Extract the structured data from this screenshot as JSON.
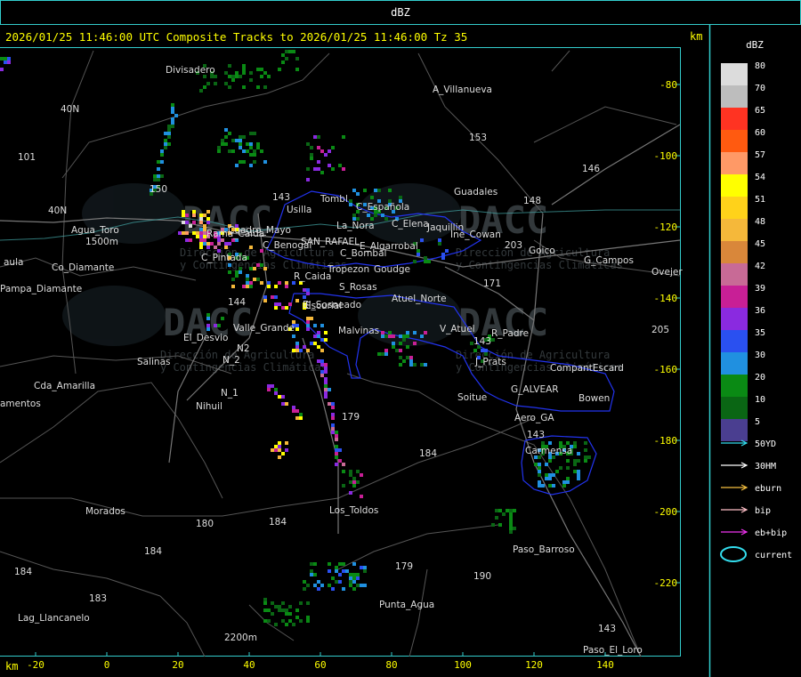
{
  "window": {
    "title": "dBZ"
  },
  "header": {
    "text": "2026/01/25 11:46:00 UTC Composite Tracks to 2026/01/25 11:46:00 Tz 35",
    "km_label": "km"
  },
  "axes": {
    "x_label": "km",
    "x_ticks": [
      "-20",
      "0",
      "20",
      "40",
      "60",
      "80",
      "100",
      "120",
      "140"
    ],
    "y_ticks": [
      "-80",
      "-100",
      "-120",
      "-140",
      "-160",
      "-180",
      "-200",
      "-220"
    ]
  },
  "legend": {
    "title": "dBZ",
    "scale": [
      {
        "label": "80",
        "color": "#dcdcdc"
      },
      {
        "label": "70",
        "color": "#bdbdbd"
      },
      {
        "label": "65",
        "color": "#ff3322"
      },
      {
        "label": "60",
        "color": "#ff5a10"
      },
      {
        "label": "57",
        "color": "#ff9966"
      },
      {
        "label": "54",
        "color": "#ffff00"
      },
      {
        "label": "51",
        "color": "#ffd21a"
      },
      {
        "label": "48",
        "color": "#f5b83a"
      },
      {
        "label": "45",
        "color": "#d9873a"
      },
      {
        "label": "42",
        "color": "#c86a96"
      },
      {
        "label": "39",
        "color": "#c81f96"
      },
      {
        "label": "36",
        "color": "#8a2ae0"
      },
      {
        "label": "35",
        "color": "#2a50f0"
      },
      {
        "label": "30",
        "color": "#2090e0"
      },
      {
        "label": "20",
        "color": "#0a8a14"
      },
      {
        "label": "10",
        "color": "#0a6614"
      },
      {
        "label": "5",
        "color": "#4a3e90"
      }
    ],
    "tracks": [
      {
        "label": "50YD",
        "color": "#33ddee"
      },
      {
        "label": "30HM",
        "color": "#ffffff"
      },
      {
        "label": "eburn",
        "color": "#f5c040"
      },
      {
        "label": "bip",
        "color": "#ffc0c8"
      },
      {
        "label": "eb+bip",
        "color": "#ee33ee"
      }
    ],
    "current_label": "current",
    "current_color": "#33ddee"
  },
  "map": {
    "watermark": {
      "brand": "DACC",
      "line1": "Dirección de Agricultura",
      "line2": "y Contingencias Climáticas"
    },
    "places": [
      {
        "name": "Divisadero",
        "x": 186,
        "y": 82
      },
      {
        "name": "A_Villanueva",
        "x": 486,
        "y": 104
      },
      {
        "name": "40N",
        "x": 68,
        "y": 126
      },
      {
        "name": "101",
        "x": 20,
        "y": 180
      },
      {
        "name": "153",
        "x": 527,
        "y": 158
      },
      {
        "name": "146",
        "x": 654,
        "y": 193
      },
      {
        "name": "150",
        "x": 168,
        "y": 216
      },
      {
        "name": "Guadales",
        "x": 510,
        "y": 219
      },
      {
        "name": "148",
        "x": 588,
        "y": 229
      },
      {
        "name": "Tombl",
        "x": 360,
        "y": 227
      },
      {
        "name": "Usilla",
        "x": 322,
        "y": 239
      },
      {
        "name": "C_Española",
        "x": 400,
        "y": 236
      },
      {
        "name": "40N",
        "x": 54,
        "y": 240
      },
      {
        "name": "143",
        "x": 306,
        "y": 225
      },
      {
        "name": "C_Elena",
        "x": 440,
        "y": 255
      },
      {
        "name": "Jaquillin",
        "x": 480,
        "y": 259
      },
      {
        "name": "La_Nora",
        "x": 378,
        "y": 257
      },
      {
        "name": "Agua_Toro",
        "x": 80,
        "y": 262
      },
      {
        "name": "1500m",
        "x": 96,
        "y": 275
      },
      {
        "name": "Rama_Caida",
        "x": 232,
        "y": 266
      },
      {
        "name": "Cuadro_Mayo",
        "x": 256,
        "y": 262
      },
      {
        "name": "Ine_Cowan",
        "x": 506,
        "y": 267
      },
      {
        "name": "SAN_RAFAEL",
        "x": 338,
        "y": 275
      },
      {
        "name": "C_Benogai",
        "x": 295,
        "y": 279
      },
      {
        "name": "E_Algarrobal",
        "x": 404,
        "y": 280
      },
      {
        "name": "203",
        "x": 567,
        "y": 279
      },
      {
        "name": "Goico",
        "x": 594,
        "y": 285
      },
      {
        "name": "C_Bombal",
        "x": 382,
        "y": 288
      },
      {
        "name": "G_Campos",
        "x": 656,
        "y": 296
      },
      {
        "name": "aula",
        "x": 4,
        "y": 298
      },
      {
        "name": "Co_Diamante",
        "x": 58,
        "y": 304
      },
      {
        "name": "C_Pintada",
        "x": 226,
        "y": 293
      },
      {
        "name": "Tropezon",
        "x": 368,
        "y": 306
      },
      {
        "name": "Goudge",
        "x": 420,
        "y": 306
      },
      {
        "name": "Ovejer",
        "x": 732,
        "y": 309
      },
      {
        "name": "R_Caida",
        "x": 330,
        "y": 314
      },
      {
        "name": "171",
        "x": 543,
        "y": 322
      },
      {
        "name": "S_Rosas",
        "x": 381,
        "y": 326
      },
      {
        "name": "Pampa_Diamante",
        "x": 0,
        "y": 328
      },
      {
        "name": "Atuel_Norte",
        "x": 440,
        "y": 339
      },
      {
        "name": "144",
        "x": 256,
        "y": 343
      },
      {
        "name": "El_Sosneado",
        "x": 340,
        "y": 346
      },
      {
        "name": "Escurial",
        "x": 343,
        "y": 347
      },
      {
        "name": "205",
        "x": 732,
        "y": 374
      },
      {
        "name": "V_Atuel",
        "x": 494,
        "y": 373
      },
      {
        "name": "R_Padre",
        "x": 552,
        "y": 378
      },
      {
        "name": "Valle_Grande",
        "x": 262,
        "y": 372
      },
      {
        "name": "Malvinas",
        "x": 380,
        "y": 375
      },
      {
        "name": "El_Desvio",
        "x": 206,
        "y": 383
      },
      {
        "name": "143",
        "x": 532,
        "y": 387
      },
      {
        "name": "N2",
        "x": 266,
        "y": 395
      },
      {
        "name": "Salinas",
        "x": 154,
        "y": 410
      },
      {
        "name": "J_Prats",
        "x": 534,
        "y": 410
      },
      {
        "name": "CompantEscard",
        "x": 618,
        "y": 417
      },
      {
        "name": "N_2",
        "x": 250,
        "y": 408
      },
      {
        "name": "Cda_Amarilla",
        "x": 38,
        "y": 437
      },
      {
        "name": "G_ALVEAR",
        "x": 574,
        "y": 441
      },
      {
        "name": "N_1",
        "x": 248,
        "y": 445
      },
      {
        "name": "Soitue",
        "x": 514,
        "y": 450
      },
      {
        "name": "Bowen",
        "x": 650,
        "y": 451
      },
      {
        "name": "amentos",
        "x": 0,
        "y": 457
      },
      {
        "name": "Nihuil",
        "x": 220,
        "y": 460
      },
      {
        "name": "179",
        "x": 384,
        "y": 472
      },
      {
        "name": "Aero_GA",
        "x": 578,
        "y": 473
      },
      {
        "name": "143",
        "x": 592,
        "y": 492
      },
      {
        "name": "184",
        "x": 471,
        "y": 513
      },
      {
        "name": "Carmensa",
        "x": 590,
        "y": 510
      },
      {
        "name": "Los_Toldos",
        "x": 370,
        "y": 577
      },
      {
        "name": "Morados",
        "x": 96,
        "y": 578
      },
      {
        "name": "184",
        "x": 302,
        "y": 590
      },
      {
        "name": "180",
        "x": 220,
        "y": 592
      },
      {
        "name": "Paso_Barroso",
        "x": 576,
        "y": 621
      },
      {
        "name": "184",
        "x": 162,
        "y": 623
      },
      {
        "name": "184",
        "x": 16,
        "y": 646
      },
      {
        "name": "179",
        "x": 444,
        "y": 640
      },
      {
        "name": "190",
        "x": 532,
        "y": 651
      },
      {
        "name": "183",
        "x": 100,
        "y": 676
      },
      {
        "name": "Punta_Agua",
        "x": 426,
        "y": 683
      },
      {
        "name": "Lag_Llancanelo",
        "x": 20,
        "y": 698
      },
      {
        "name": "2200m",
        "x": 252,
        "y": 720
      },
      {
        "name": "143",
        "x": 672,
        "y": 710
      },
      {
        "name": "Paso_El_Loro",
        "x": 655,
        "y": 734
      }
    ]
  }
}
